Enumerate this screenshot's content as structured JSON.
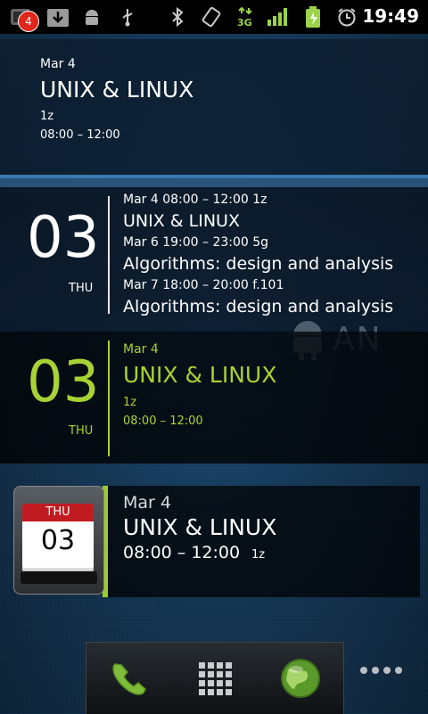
{
  "status_bar": {
    "notification_count": "4",
    "clock": "19:49",
    "network_label": "3G",
    "icons": [
      "notification-icon",
      "download-icon",
      "android-debug-icon",
      "usb-icon",
      "bluetooth-icon",
      "rotate-icon",
      "network-3g-icon",
      "signal-icon",
      "battery-charging-icon",
      "alarm-icon"
    ]
  },
  "widget_simple": {
    "date": "Mar 4",
    "title": "UNIX & LINUX",
    "location": "1z",
    "time": "08:00 – 12:00"
  },
  "widget_agenda": {
    "day_number": "03",
    "day_name": "THU",
    "events": [
      {
        "meta": "Mar 4    08:00 – 12:00    1z",
        "title": "UNIX & LINUX"
      },
      {
        "meta": "Mar 6    19:00 – 23:00    5g",
        "title": "Algorithms: design and analysis"
      },
      {
        "meta": "Mar 7    18:00 – 20:00    f.101",
        "title": "Algorithms: design and analysis"
      }
    ]
  },
  "widget_green": {
    "day_number": "03",
    "day_name": "THU",
    "date": "Mar 4",
    "title": "UNIX & LINUX",
    "location": "1z",
    "time": "08:00 – 12:00",
    "accent": "#a8d134"
  },
  "widget_icon": {
    "icon_month_day": "THU",
    "icon_day_number": "03",
    "date": "Mar 4",
    "title": "UNIX & LINUX",
    "time": "08:00 – 12:00",
    "location": "1z",
    "accent": "#9bcc2c"
  },
  "wallpaper": {
    "watermark_text": "AN"
  },
  "dock": {
    "items": [
      "phone-icon",
      "app-drawer-icon",
      "browser-globe-icon"
    ],
    "more": "more-icon"
  }
}
